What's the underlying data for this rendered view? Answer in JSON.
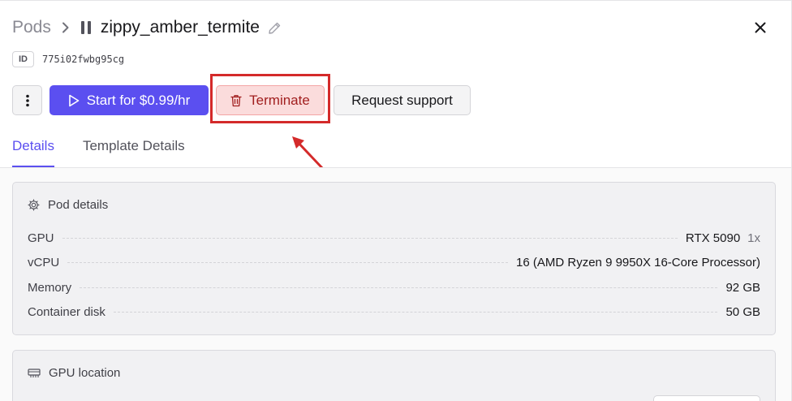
{
  "breadcrumb": {
    "root": "Pods"
  },
  "pod": {
    "name": "zippy_amber_termite",
    "id_label": "ID",
    "id_value": "775i02fwbg95cg"
  },
  "actions": {
    "start_label": "Start for $0.99/hr",
    "terminate_label": "Terminate",
    "support_label": "Request support"
  },
  "tabs": [
    {
      "label": "Details",
      "active": true
    },
    {
      "label": "Template Details",
      "active": false
    }
  ],
  "pod_details": {
    "title": "Pod details",
    "rows": [
      {
        "label": "GPU",
        "value": "RTX 5090",
        "qty": "1x"
      },
      {
        "label": "vCPU",
        "value": "16 (AMD Ryzen 9 9950X 16-Core Processor)"
      },
      {
        "label": "Memory",
        "value": "92 GB"
      },
      {
        "label": "Container disk",
        "value": "50 GB"
      }
    ]
  },
  "gpu_location": {
    "title": "GPU location"
  },
  "colors": {
    "accent": "#5b4ff0",
    "danger": "#a11f1f",
    "highlight": "#d42a2a"
  },
  "icons": [
    "chevron-right-icon",
    "pause-icon",
    "pencil-icon",
    "close-icon",
    "kebab-menu-icon",
    "play-icon",
    "trash-icon",
    "gear-icon",
    "server-icon"
  ]
}
